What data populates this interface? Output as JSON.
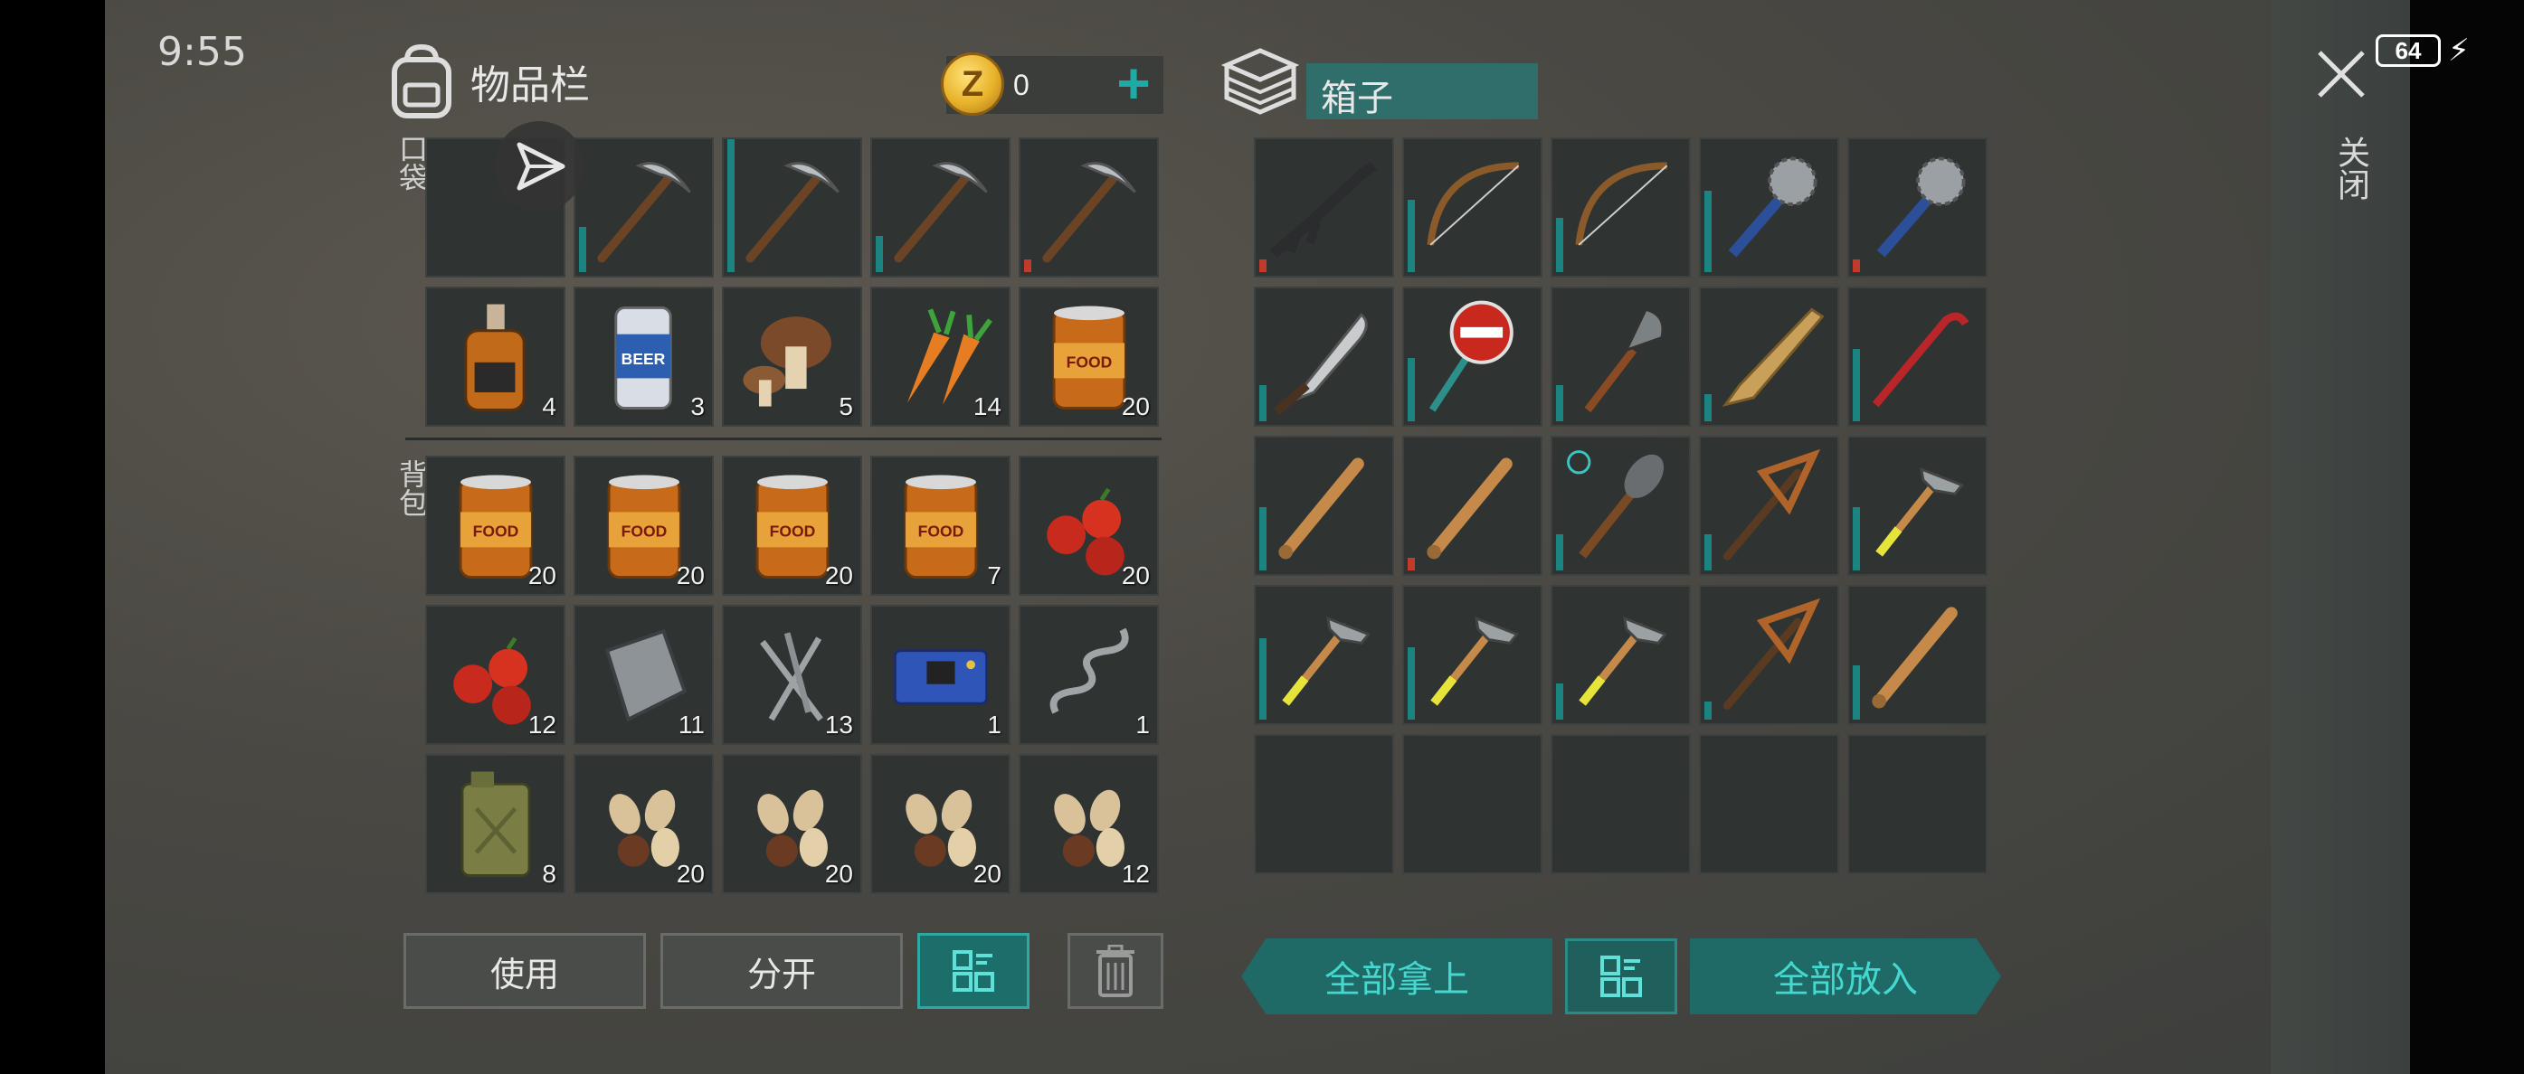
{
  "status_bar": {
    "time": "9:55",
    "battery": "64"
  },
  "inventory": {
    "title": "物品栏",
    "coins": "0",
    "pocket_label": "口袋",
    "backpack_label": "背包",
    "pocket_slots": [
      {
        "item": "send-icon",
        "qty": ""
      },
      {
        "item": "pickaxe-icon",
        "qty": ""
      },
      {
        "item": "pickaxe-icon",
        "qty": ""
      },
      {
        "item": "pickaxe-icon",
        "qty": ""
      },
      {
        "item": "pickaxe-icon",
        "qty": ""
      },
      {
        "item": "whiskey-bottle-icon",
        "qty": "4"
      },
      {
        "item": "beer-can-icon",
        "qty": "3"
      },
      {
        "item": "mushroom-icon",
        "qty": "5"
      },
      {
        "item": "carrot-icon",
        "qty": "14"
      },
      {
        "item": "canned-food-icon",
        "qty": "20"
      }
    ],
    "backpack_slots": [
      {
        "item": "canned-food-icon",
        "qty": "20"
      },
      {
        "item": "canned-food-icon",
        "qty": "20"
      },
      {
        "item": "canned-food-icon",
        "qty": "20"
      },
      {
        "item": "canned-food-icon",
        "qty": "7"
      },
      {
        "item": "berries-icon",
        "qty": "20"
      },
      {
        "item": "berries-icon",
        "qty": "12"
      },
      {
        "item": "metal-plate-icon",
        "qty": "11"
      },
      {
        "item": "nails-icon",
        "qty": "13"
      },
      {
        "item": "circuit-board-icon",
        "qty": "1"
      },
      {
        "item": "spring-icon",
        "qty": "1"
      },
      {
        "item": "jerrycan-icon",
        "qty": "8"
      },
      {
        "item": "seeds-icon",
        "qty": "20"
      },
      {
        "item": "seeds-icon",
        "qty": "20"
      },
      {
        "item": "seeds-icon",
        "qty": "20"
      },
      {
        "item": "seeds-icon",
        "qty": "12"
      }
    ],
    "buttons": {
      "use": "使用",
      "split": "分开"
    }
  },
  "chest": {
    "title": "箱子",
    "slots": [
      {
        "item": "assault-rifle-icon"
      },
      {
        "item": "bow-icon"
      },
      {
        "item": "bow-icon"
      },
      {
        "item": "saw-mace-icon"
      },
      {
        "item": "saw-mace-icon"
      },
      {
        "item": "machete-icon"
      },
      {
        "item": "stop-sign-icon"
      },
      {
        "item": "shovel-icon"
      },
      {
        "item": "wooden-plank-icon"
      },
      {
        "item": "crowbar-icon"
      },
      {
        "item": "baseball-bat-icon"
      },
      {
        "item": "baseball-bat-icon"
      },
      {
        "item": "spiked-club-icon"
      },
      {
        "item": "copper-pickaxe-icon"
      },
      {
        "item": "hammer-icon"
      },
      {
        "item": "hammer-icon"
      },
      {
        "item": "hammer-icon"
      },
      {
        "item": "hammer-icon"
      },
      {
        "item": "copper-pickaxe-icon"
      },
      {
        "item": "baseball-bat-icon"
      }
    ],
    "buttons": {
      "take_all": "全部拿上",
      "put_all": "全部放入"
    }
  },
  "close_label": "关闭",
  "colors": {
    "accent": "#1faaa5",
    "panel": "#2f3331",
    "durability": "#1c8480",
    "durability_low": "#c43a2a"
  }
}
